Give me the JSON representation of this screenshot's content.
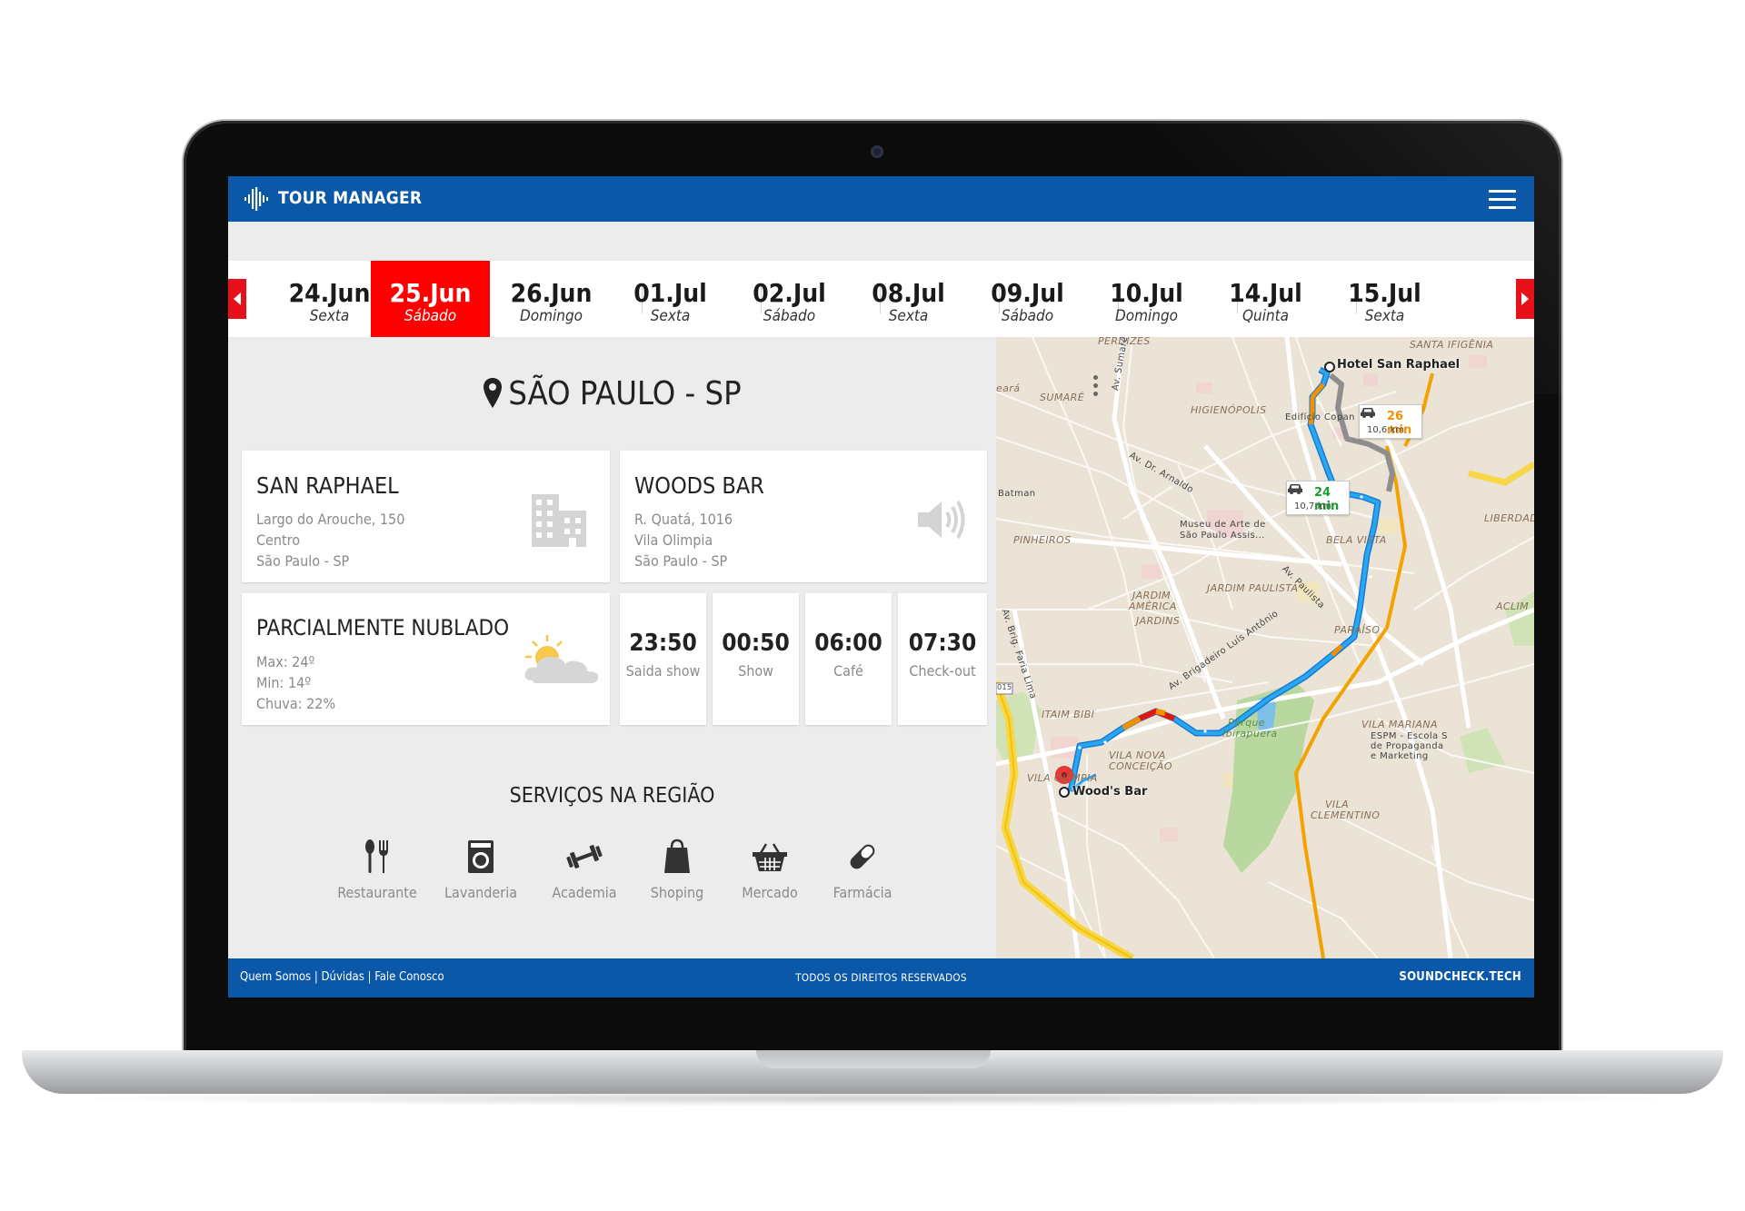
{
  "app": {
    "brand": "TOUR MANAGER"
  },
  "dates": [
    {
      "date": "24.Jun",
      "weekday": "Sexta"
    },
    {
      "date": "25.Jun",
      "weekday": "Sábado",
      "active": true
    },
    {
      "date": "26.Jun",
      "weekday": "Domingo"
    },
    {
      "date": "01.Jul",
      "weekday": "Sexta"
    },
    {
      "date": "02.Jul",
      "weekday": "Sábado"
    },
    {
      "date": "08.Jul",
      "weekday": "Sexta"
    },
    {
      "date": "09.Jul",
      "weekday": "Sábado"
    },
    {
      "date": "10.Jul",
      "weekday": "Domingo"
    },
    {
      "date": "14.Jul",
      "weekday": "Quinta"
    },
    {
      "date": "15.Jul",
      "weekday": "Sexta"
    }
  ],
  "city": "SÃO PAULO - SP",
  "hotel": {
    "name": "SAN RAPHAEL",
    "address1": "Largo do Arouche, 150",
    "address2": "Centro",
    "address3": "São Paulo - SP",
    "icon": "building-icon"
  },
  "venue": {
    "name": "WOODS BAR",
    "address1": "R. Quatá, 1016",
    "address2": "Vila Olimpia",
    "address3": "São Paulo - SP",
    "icon": "speaker-icon"
  },
  "weather": {
    "condition": "PARCIALMENTE NUBLADO",
    "max": "Max: 24º",
    "min": "Min: 14º",
    "rain": "Chuva: 22%",
    "icon": "partly-cloudy-icon"
  },
  "schedule": [
    {
      "time": "23:50",
      "label": "Saida show"
    },
    {
      "time": "00:50",
      "label": "Show"
    },
    {
      "time": "06:00",
      "label": "Café"
    },
    {
      "time": "07:30",
      "label": "Check-out"
    }
  ],
  "services": {
    "title": "SERVIÇOS NA REGIÃO",
    "items": [
      {
        "label": "Restaurante",
        "icon": "fork-knife-icon"
      },
      {
        "label": "Lavanderia",
        "icon": "washing-machine-icon"
      },
      {
        "label": "Academia",
        "icon": "dumbbell-icon"
      },
      {
        "label": "Shoping",
        "icon": "shopping-bag-icon"
      },
      {
        "label": "Mercado",
        "icon": "basket-icon"
      },
      {
        "label": "Farmácia",
        "icon": "pill-icon"
      }
    ]
  },
  "map": {
    "origin": "Hotel San Raphael",
    "destination": "Wood's Bar",
    "route_primary": {
      "time": "24 min",
      "distance": "10,7 km",
      "color": "#1a9c2e"
    },
    "route_alt": {
      "time": "26 min",
      "distance": "10,6 km",
      "color": "#f29000"
    },
    "labels": {
      "perdizes": "PERDIZES",
      "santa_ifigenia": "SANTA IFIGÊNIA",
      "sumare": "SUMARÉ",
      "av_sumare": "Av. Sumaré",
      "higienopolis": "HIGIENÓPOLIS",
      "edificio": "Edifício Copan",
      "av_arnaldo": "Av. Dr. Arnaldo",
      "batman": "Batman",
      "museu1": "Museu de Arte de",
      "museu2": "São Paulo Assis...",
      "liberdade": "LIBERDAD",
      "pinheiros": "PINHEIROS",
      "bela_vista": "BELA VISTA",
      "av_paulista": "Av. Paulista",
      "jardim_america1": "JARDIM",
      "jardim_america2": "AMÉRICA",
      "jardim_paulista": "JARDIM PAULISTA",
      "aclim": "ACLIM",
      "jardins": "JARDINS",
      "faria_lima": "Av. Brig. Faria Lima",
      "paraiso": "PARAÍSO",
      "brigadeiro": "Av. Brigadeiro Luís Antônio",
      "itaim": "ITAIM BIBI",
      "parque1": "Parque",
      "parque2": "Ibirapuera",
      "vila_mariana": "VILA MARIANA",
      "espm1": "ESPM - Escola S",
      "espm2": "de Propaganda",
      "espm3": "e Marketing",
      "vila_nova1": "VILA NOVA",
      "vila_nova2": "CONCEIÇÃO",
      "vila_olimpia": "VILA OLÍMPIA",
      "vila_clementino": "VILA",
      "vila_clementino2": "CLEMENTINO",
      "shield": "015",
      "ceara": "eará"
    },
    "colors": {
      "route": "#1ea6f0",
      "traffic_orange": "#f29000",
      "traffic_red": "#e3170a",
      "park": "#b9d8a0"
    }
  },
  "footer": {
    "link1": "Quem Somos",
    "link2": "Dúvidas",
    "link3": "Fale Conosco",
    "center": "TODOS OS DIREITOS RESERVADOS",
    "right": "SOUNDCHECK.TECH"
  },
  "colors": {
    "brand_blue": "#0b58a9",
    "accent_red": "#ff0000"
  }
}
